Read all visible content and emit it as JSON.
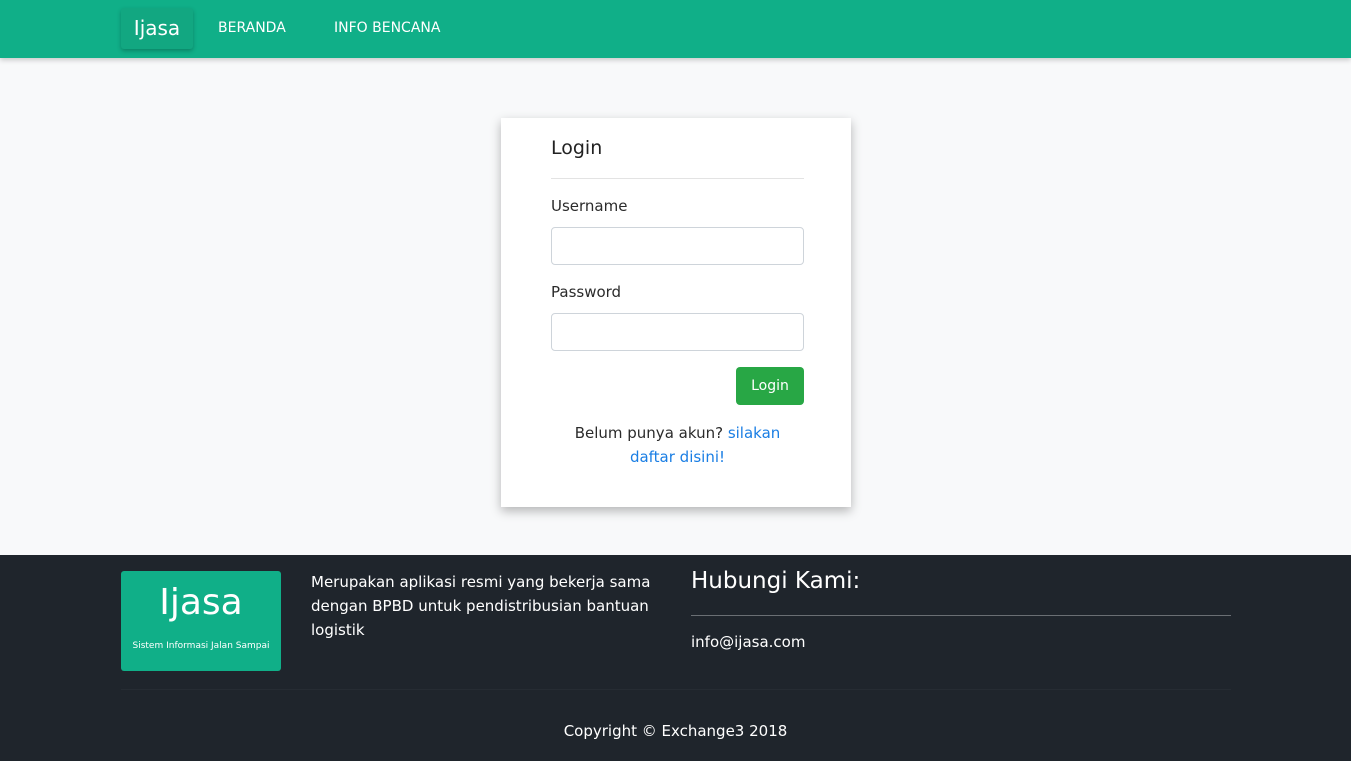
{
  "navbar": {
    "brand": "Ijasa",
    "links": [
      "BERANDA",
      "INFO BENCANA"
    ]
  },
  "login": {
    "title": "Login",
    "username_label": "Username",
    "username_value": "",
    "password_label": "Password",
    "password_value": "",
    "button_label": "Login",
    "register_prompt": "Belum punya akun?",
    "register_link": "silakan daftar disini!"
  },
  "footer": {
    "logo_name": "Ijasa",
    "logo_subtitle": "Sistem Informasi Jalan Sampai",
    "description": "Merupakan aplikasi resmi yang bekerja sama dengan BPBD untuk pendistribusian bantuan logistik",
    "contact_title": "Hubungi Kami:",
    "contact_email": "info@ijasa.com",
    "copyright": "Copyright © Exchange3 2018"
  },
  "colors": {
    "primary": "#10af88",
    "success": "#28a745",
    "link": "#1a7ee4",
    "footer_bg": "#1f252c"
  }
}
